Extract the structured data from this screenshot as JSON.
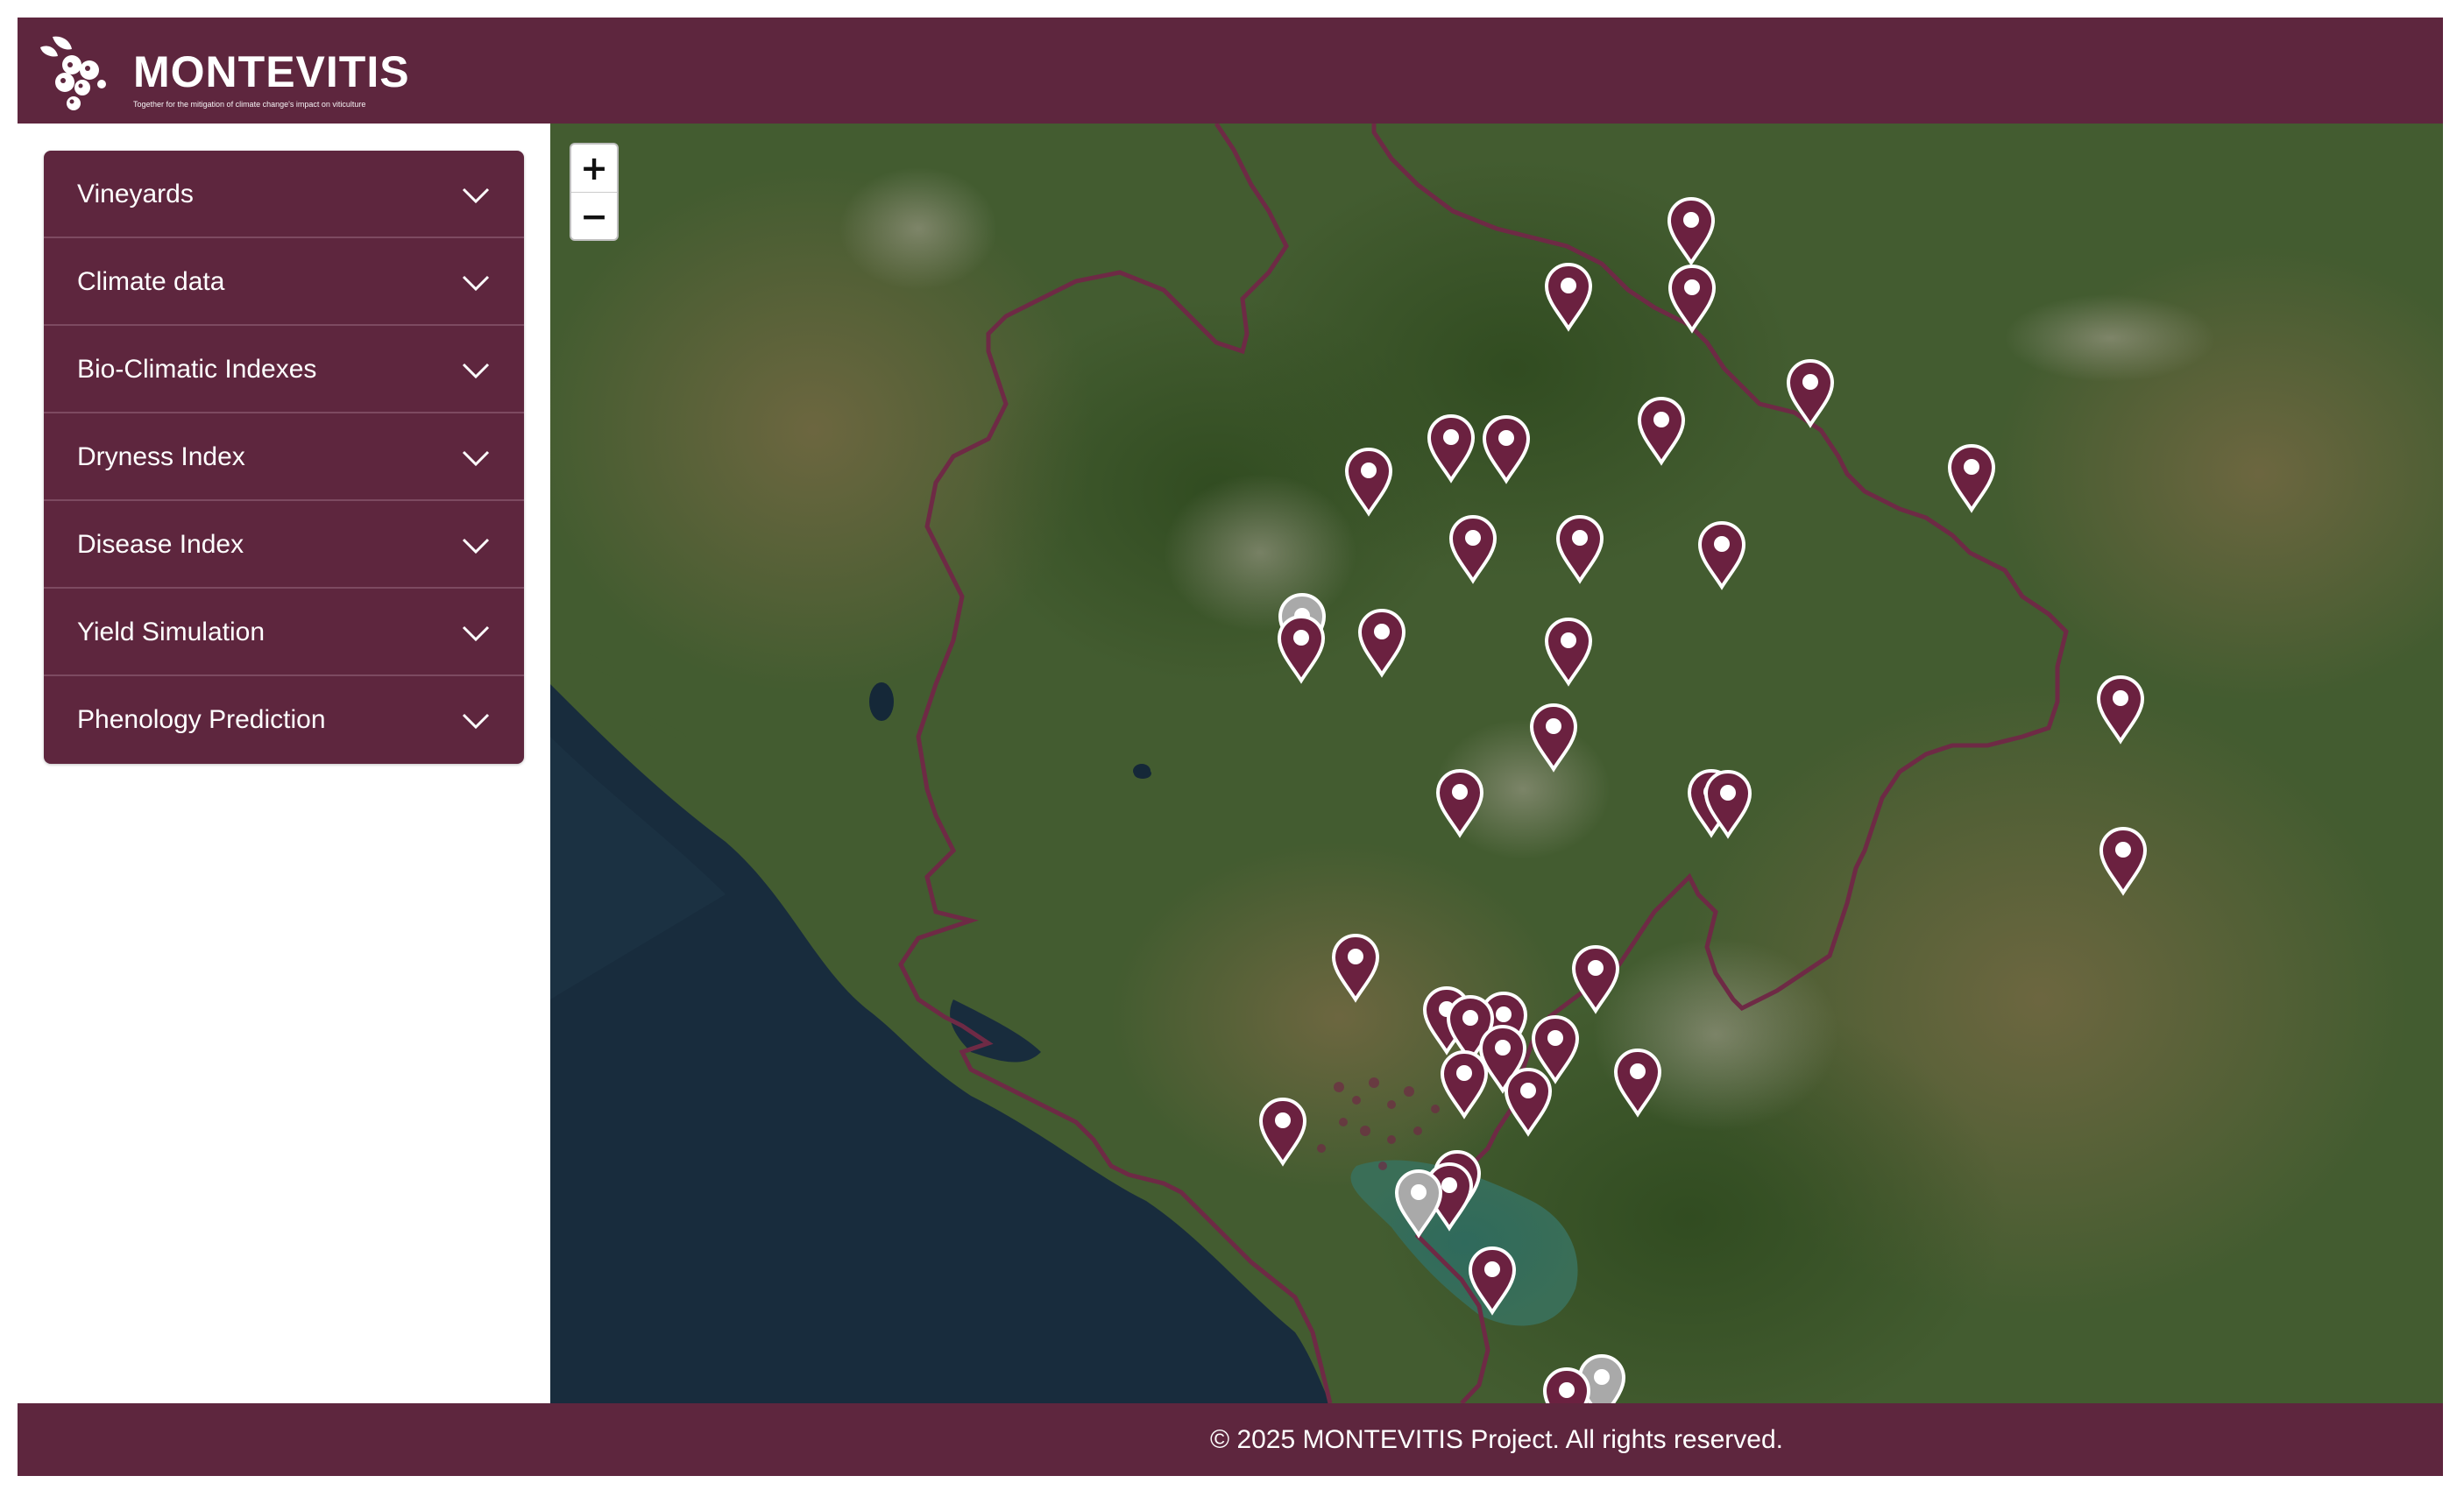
{
  "header": {
    "brand_name": "MONTEVITIS",
    "tagline": "Together for the mitigation of climate change's impact on viticulture",
    "background_color": "#5e263e"
  },
  "sidebar": {
    "items": [
      {
        "label": "Vineyards",
        "icon": "chevron-down-icon"
      },
      {
        "label": "Climate data",
        "icon": "chevron-down-icon"
      },
      {
        "label": "Bio-Climatic Indexes",
        "icon": "chevron-down-icon"
      },
      {
        "label": "Dryness Index",
        "icon": "chevron-down-icon"
      },
      {
        "label": "Disease Index",
        "icon": "chevron-down-icon"
      },
      {
        "label": "Yield Simulation",
        "icon": "chevron-down-icon"
      },
      {
        "label": "Phenology Prediction",
        "icon": "chevron-down-icon"
      }
    ]
  },
  "map": {
    "zoom_in_label": "+",
    "zoom_out_label": "−",
    "marker_color": "#6b2140",
    "inactive_marker_color": "#a9a9a9",
    "border_color": "#6e2a45",
    "marker_icon": "map-pin-icon"
  },
  "footer": {
    "copyright": "© 2025 MONTEVITIS Project. All rights reserved."
  }
}
